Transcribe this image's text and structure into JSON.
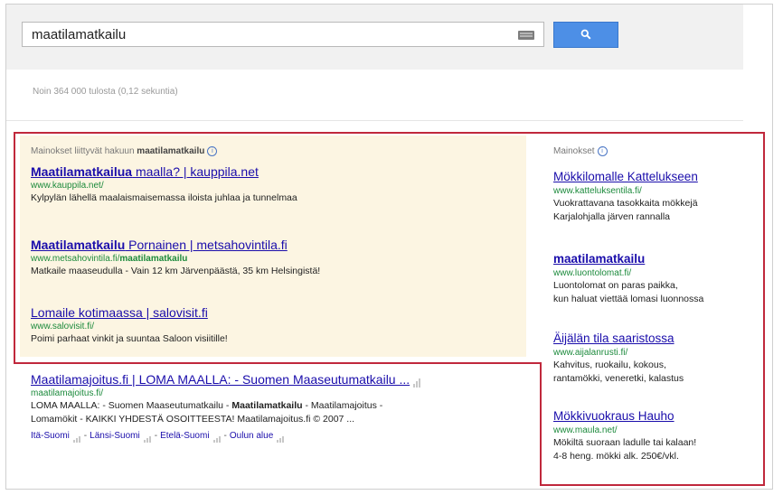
{
  "search": {
    "query": "maatilamatkailu"
  },
  "results_stats": "Noin 364 000 tulosta (0,12 sekuntia)",
  "top_ads": {
    "label_prefix": "Mainokset liittyvät hakuun",
    "label_query": "maatilamatkailu",
    "items": [
      {
        "title_bold": "Maatilamatkailua",
        "title_rest": " maalla? | kauppila.net",
        "url": "www.kauppila.net/",
        "url_bold": "",
        "desc": "Kylpylän lähellä maalaismaisemassa iloista juhlaa ja tunnelmaa"
      },
      {
        "title_bold": "Maatilamatkailu",
        "title_rest": " Pornainen | metsahovintila.fi",
        "url": "www.metsahovintila.fi/",
        "url_bold": "maatilamatkailu",
        "desc": "Matkaile maaseudulla - Vain 12 km Järvenpäästä, 35 km Helsingistä!"
      },
      {
        "title_bold": "",
        "title_rest": "Lomaile kotimaassa | salovisit.fi",
        "url": "www.salovisit.fi/",
        "url_bold": "",
        "desc": "Poimi parhaat vinkit ja suuntaa Saloon visiitille!"
      }
    ]
  },
  "organic": {
    "title": "Maatilamajoitus.fi | LOMA MAALLA: - Suomen Maaseutumatkailu ...",
    "url": "maatilamajoitus.fi/",
    "desc_line1_a": "LOMA MAALLA: - Suomen Maaseutumatkailu - ",
    "desc_line1_bold": "Maatilamatkailu",
    "desc_line1_b": " - Maatilamajoitus -",
    "desc_line2": "Lomamökit - KAIKKI YHDESTÄ OSOITTEESTA! Maatilamajoitus.fi © 2007 ...",
    "sitelinks": [
      "Itä-Suomi",
      "Länsi-Suomi",
      "Etelä-Suomi",
      "Oulun alue"
    ]
  },
  "side_ads": {
    "label": "Mainokset",
    "items": [
      {
        "title": "Mökkilomalle Kattelukseen",
        "title_bold": false,
        "url": "www.katteluksentila.fi/",
        "desc1": "Vuokrattavana tasokkaita mökkejä",
        "desc2": "Karjalohjalla järven rannalla"
      },
      {
        "title": "maatilamatkailu",
        "title_bold": true,
        "url": "www.luontolomat.fi/",
        "desc1": "Luontolomat on paras paikka,",
        "desc2": "kun haluat viettää lomasi luonnossa"
      },
      {
        "title": "Äijälän tila saaristossa",
        "title_bold": false,
        "url": "www.aijalanrusti.fi/",
        "desc1": "Kahvitus, ruokailu, kokous,",
        "desc2": "rantamökki, veneretki, kalastus"
      },
      {
        "title": "Mökkivuokraus Hauho",
        "title_bold": false,
        "url": "www.maula.net/",
        "desc1": "Mökiltä suoraan ladulle tai kalaan!",
        "desc2": "4-8 heng. mökki alk. 250€/vkl."
      }
    ]
  },
  "colors": {
    "link": "#1a0dab",
    "url_green": "#1c8a3c",
    "ad_background": "#fcf5e2",
    "highlight_outline": "#c0283c",
    "search_button": "#4d8fe6"
  }
}
